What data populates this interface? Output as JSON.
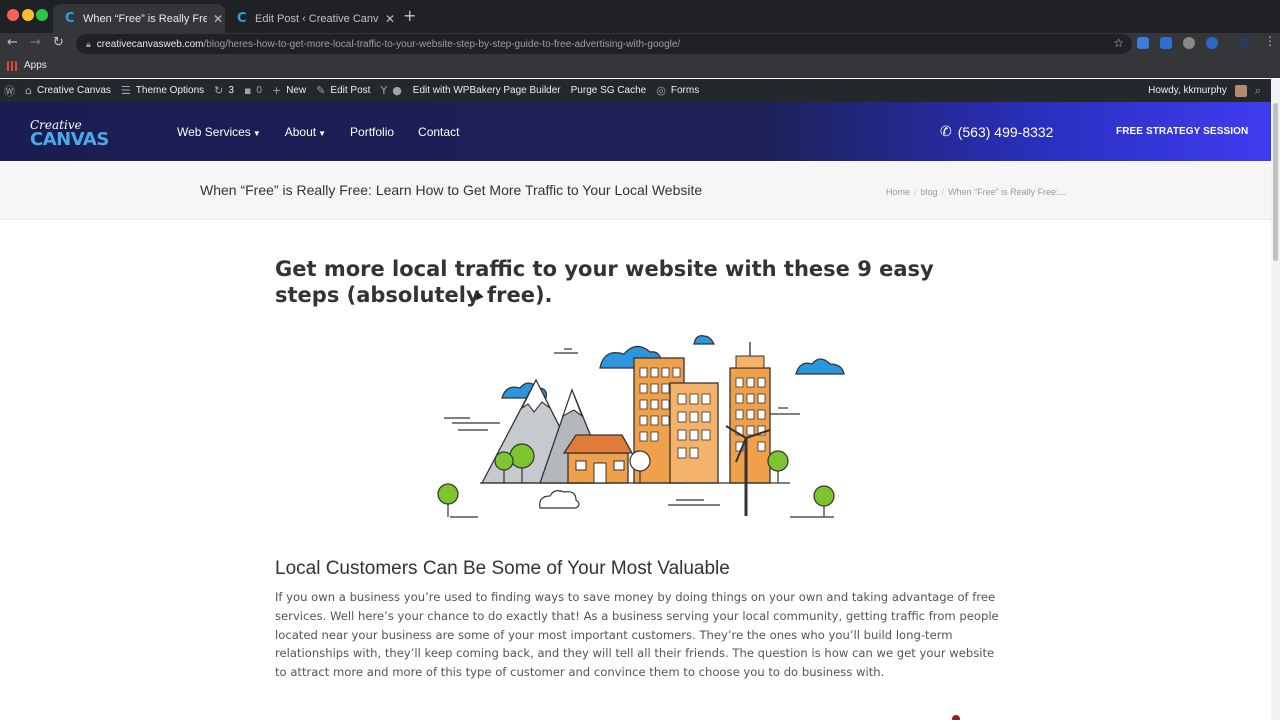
{
  "browser": {
    "tabs": [
      {
        "title": "When “Free” is Really Free: Learn",
        "icon": "creative-canvas-favicon"
      },
      {
        "title": "Edit Post ‹ Creative Canvas — W",
        "icon": "creative-canvas-favicon"
      }
    ],
    "url_domain": "creativecanvasweb.com",
    "url_path": "/blog/heres-how-to-get-more-local-traffic-to-your-website-step-by-step-guide-to-free-advertising-with-google/",
    "bookmarks": {
      "apps_label": "Apps"
    }
  },
  "wp_admin": {
    "site_name": "Creative Canvas",
    "theme_options": "Theme Options",
    "updates_count": "3",
    "comments_count": "0",
    "new_label": "New",
    "edit_post": "Edit Post",
    "wpbakery": "Edit with WPBakery Page Builder",
    "purge": "Purge SG Cache",
    "forms": "Forms",
    "howdy": "Howdy, kkmurphy"
  },
  "header": {
    "logo_top": "Creative",
    "logo_bottom": "CANVAS",
    "nav": [
      "Web Services",
      "About",
      "Portfolio",
      "Contact"
    ],
    "phone": "(563) 499-8332",
    "cta": "FREE STRATEGY SESSION"
  },
  "titlebar": {
    "title": "When “Free” is Really Free: Learn How to Get More Traffic to Your Local Website",
    "breadcrumbs": [
      "Home",
      "blog",
      "When “Free” is Really Free:..."
    ]
  },
  "article": {
    "heading": "Get more local traffic to your website with these 9 easy steps (absolutely free).",
    "subheading": "Local Customers Can Be Some of Your Most Valuable",
    "paragraph": "If you own a business you’re used to finding ways to save money by doing things on your own and taking advantage of free services. Well here’s your chance to do exactly that! As a business serving your local community, getting traffic from people located near your business are some of your most important customers. They’re the ones who you’ll build long-term relationships with, they’ll keep coming back, and they will tell all their friends. The question is how can we get your website to attract more and more of this type of customer and convince them to choose you to do business with."
  },
  "colors": {
    "header_dark": "#191d52",
    "header_accent": "#3f3cf0",
    "logo_blue": "#4aa9e6"
  }
}
